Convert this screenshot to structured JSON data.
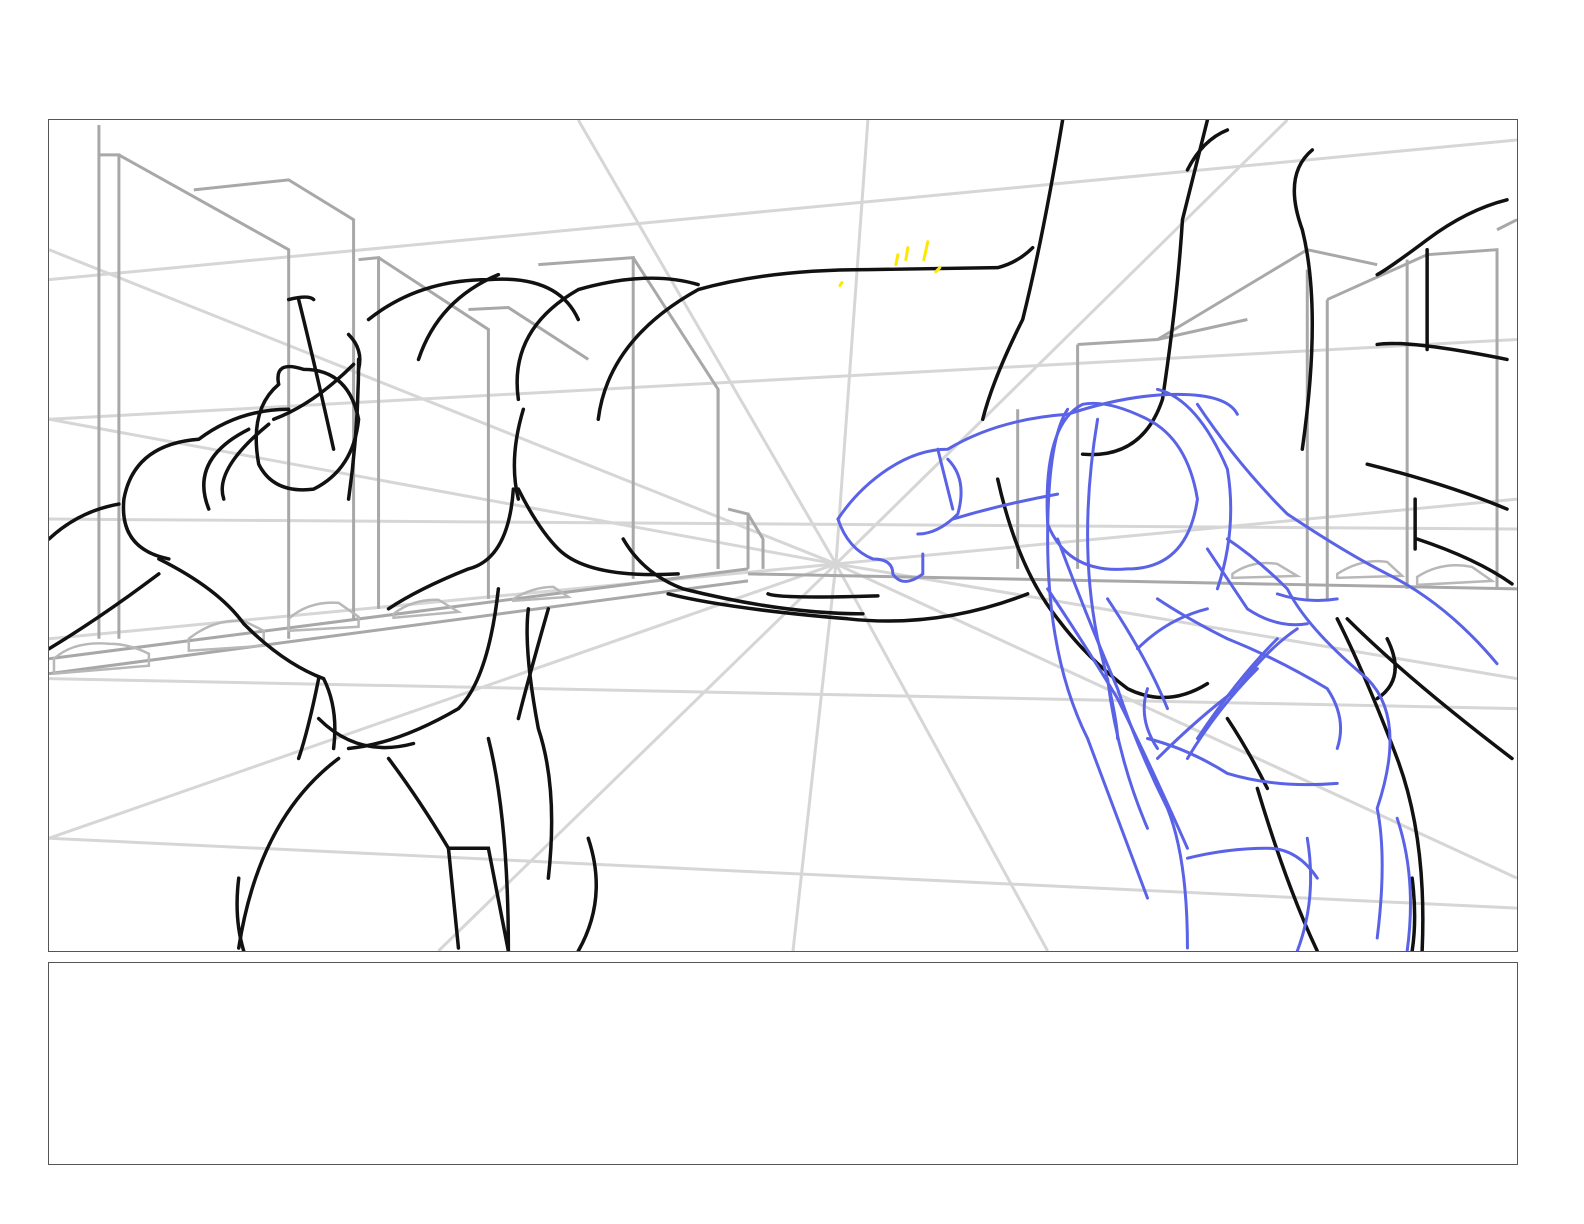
{
  "storyboard": {
    "panel_notes": "",
    "colors": {
      "frame_border": "#555555",
      "perspective_lines": "#d0d0d0",
      "buildings": "#a8a8a8",
      "character_ink": "#111111",
      "rough_sketch": "#5a63e6",
      "highlight": "#ffe800"
    }
  }
}
